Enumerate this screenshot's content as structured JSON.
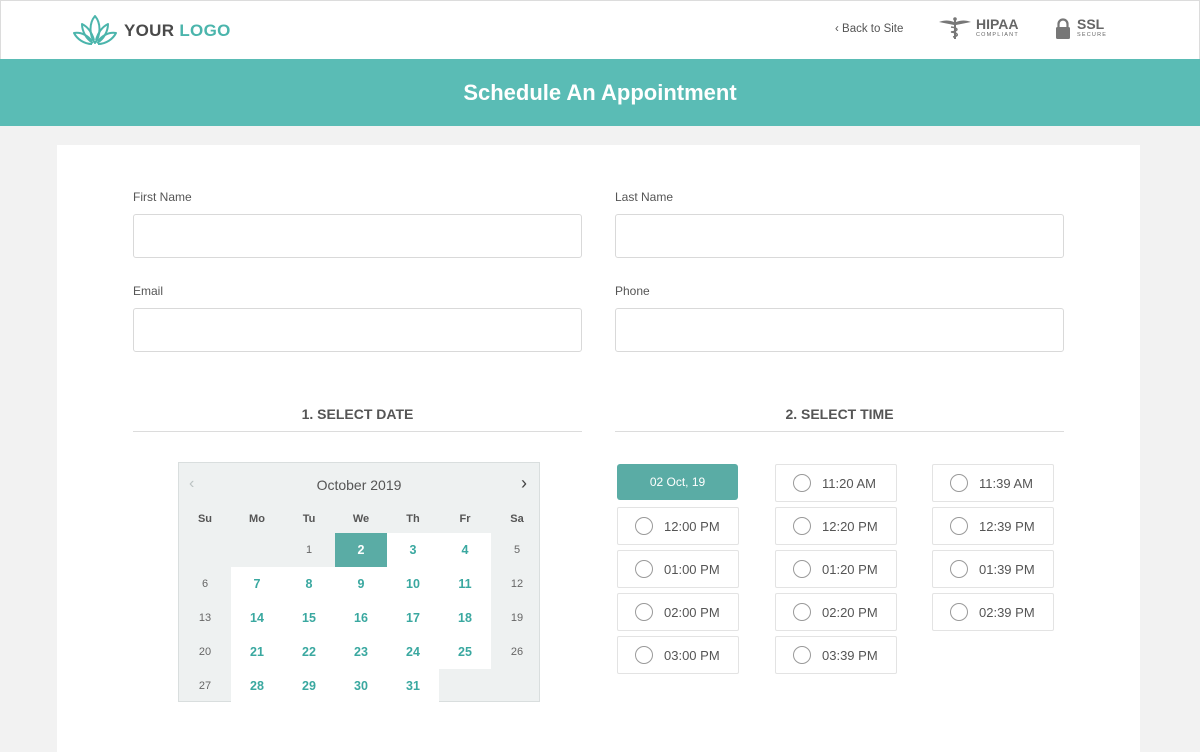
{
  "header": {
    "logo_your": "YOUR",
    "logo_logo": "LOGO",
    "back_link": "‹ Back to Site",
    "hipaa_title": "HIPAA",
    "hipaa_sub": "COMPLIANT",
    "ssl_title": "SSL",
    "ssl_sub": "SECURE"
  },
  "banner": {
    "title": "Schedule An Appointment"
  },
  "form": {
    "first_name_label": "First Name",
    "last_name_label": "Last Name",
    "email_label": "Email",
    "phone_label": "Phone",
    "first_name_value": "",
    "last_name_value": "",
    "email_value": "",
    "phone_value": ""
  },
  "sections": {
    "select_date": "1. SELECT DATE",
    "select_time": "2. SELECT TIME"
  },
  "calendar": {
    "month_label": "October 2019",
    "weekdays": [
      "Su",
      "Mo",
      "Tu",
      "We",
      "Th",
      "Fr",
      "Sa"
    ],
    "weeks": [
      [
        null,
        null,
        "1",
        "2",
        "3",
        "4",
        "5"
      ],
      [
        "6",
        "7",
        "8",
        "9",
        "10",
        "11",
        "12"
      ],
      [
        "13",
        "14",
        "15",
        "16",
        "17",
        "18",
        "19"
      ],
      [
        "20",
        "21",
        "22",
        "23",
        "24",
        "25",
        "26"
      ],
      [
        "27",
        "28",
        "29",
        "30",
        "31",
        null,
        null
      ]
    ],
    "selected_day": "2",
    "available_days": [
      "2",
      "3",
      "4",
      "7",
      "8",
      "9",
      "10",
      "11",
      "14",
      "15",
      "16",
      "17",
      "18",
      "21",
      "22",
      "23",
      "24",
      "25",
      "28",
      "29",
      "30",
      "31"
    ]
  },
  "time": {
    "selected_date": "02 Oct, 19",
    "columns": [
      [
        "12:00 PM",
        "01:00 PM",
        "02:00 PM",
        "03:00 PM"
      ],
      [
        "11:20 AM",
        "12:20 PM",
        "01:20 PM",
        "02:20 PM",
        "03:39 PM"
      ],
      [
        "11:39 AM",
        "12:39 PM",
        "01:39 PM",
        "02:39 PM"
      ]
    ]
  },
  "colors": {
    "accent": "#5abcb5",
    "selected": "#5aaca5",
    "available_text": "#3aa8a0"
  }
}
